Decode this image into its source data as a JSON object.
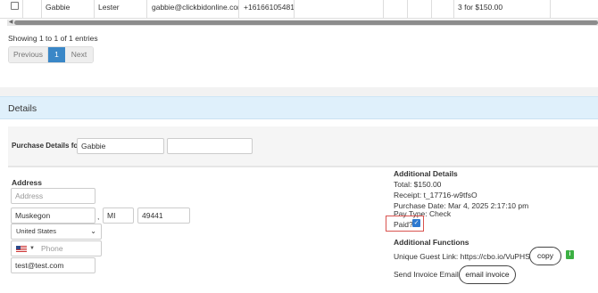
{
  "table": {
    "row": {
      "first_name": "Gabbie",
      "last_name": "Lester",
      "email": "gabbie@clickbidonline.com",
      "phone": "+16166105481",
      "items": "3 for $150.00"
    },
    "showing": "Showing 1 to 1 of 1 entries",
    "pager": {
      "previous": "Previous",
      "current": "1",
      "next": "Next"
    }
  },
  "details": {
    "title": "Details",
    "purchase_label": "Purchase Details for:",
    "purchase_name": "Gabbie",
    "address": {
      "label": "Address",
      "street_placeholder": "Address",
      "city": "Muskegon",
      "comma": ",",
      "state": "MI",
      "zip": "49441",
      "country": "United States",
      "phone_placeholder": "Phone",
      "email": "test@test.com"
    },
    "additional": {
      "label": "Additional Details",
      "total": "Total: $150.00",
      "receipt": "Receipt: t_17716-w9tfsO",
      "purchase_date": "Purchase Date: Mar 4, 2025 2:17:10 pm",
      "pay_type": "Pay Type: Check",
      "paid_label": "Paid?",
      "paid": true
    },
    "functions": {
      "label": "Additional Functions",
      "guest_link": "Unique Guest Link: https://cbo.io/VuPHSb",
      "copy": "copy",
      "send_invoice": "Send Invoice Email",
      "email_invoice": "email invoice"
    }
  },
  "colors": {
    "accent": "#3a87c7",
    "header_bg": "#dff0fb",
    "edit_icon": "#5cb85c",
    "paid_border": "#d9534f"
  }
}
